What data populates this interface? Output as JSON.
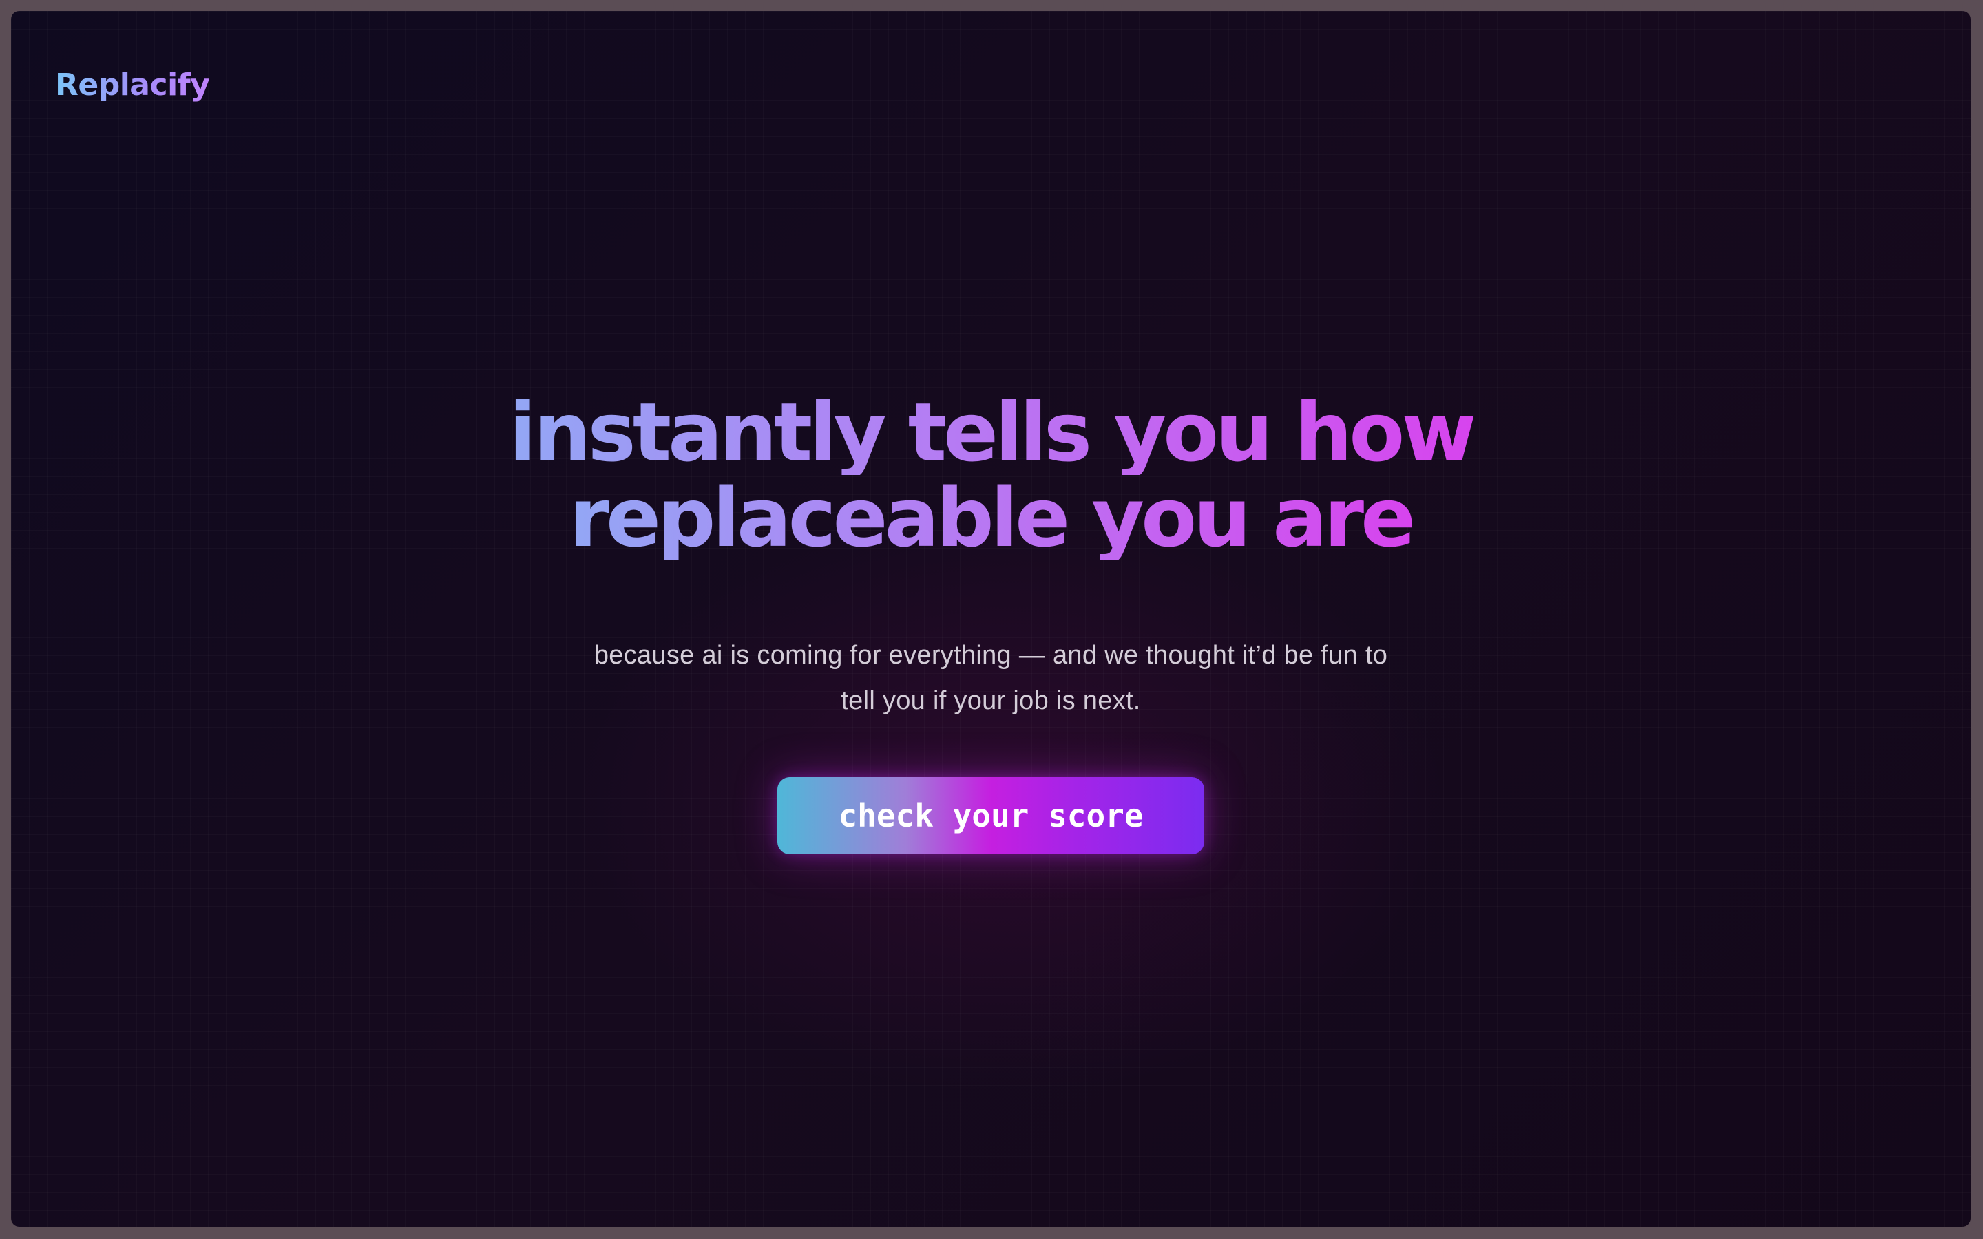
{
  "brand": {
    "logo_text": "Replacify"
  },
  "hero": {
    "headline_line1": "instantly tells you how",
    "headline_line2": "replaceable you are",
    "subtext_line1": "because ai is coming for everything — and we thought it’d be fun to",
    "subtext_line2": "tell you if your job is next.",
    "cta_label": "check your score"
  },
  "colors": {
    "background": "#13091c",
    "accent_blue": "#93a7f5",
    "accent_magenta": "#d744ee",
    "accent_violet": "#7b2cf0",
    "button_start": "#4fb7d8"
  }
}
